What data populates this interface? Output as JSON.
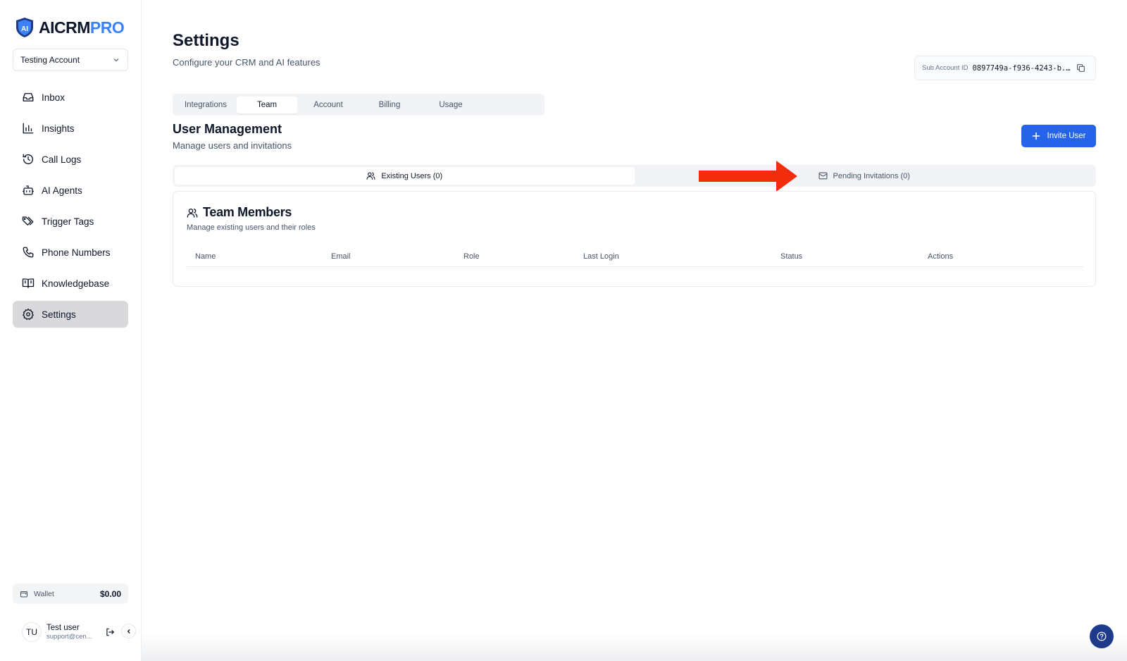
{
  "brand": {
    "name_part1": "AICRM",
    "name_part2": "PRO"
  },
  "account_selector": {
    "value": "Testing Account"
  },
  "sidebar": {
    "items": [
      {
        "label": "Inbox",
        "icon": "inbox-icon"
      },
      {
        "label": "Insights",
        "icon": "bar-chart-icon"
      },
      {
        "label": "Call Logs",
        "icon": "history-icon"
      },
      {
        "label": "AI Agents",
        "icon": "bot-icon"
      },
      {
        "label": "Trigger Tags",
        "icon": "tags-icon"
      },
      {
        "label": "Phone Numbers",
        "icon": "phone-icon"
      },
      {
        "label": "Knowledgebase",
        "icon": "book-icon"
      },
      {
        "label": "Settings",
        "icon": "gear-icon",
        "active": true
      }
    ]
  },
  "wallet": {
    "label": "Wallet",
    "amount": "$0.00"
  },
  "user": {
    "initials": "TU",
    "name": "Test user",
    "email": "support@cen..."
  },
  "header": {
    "title": "Settings",
    "subtitle": "Configure your CRM and AI features",
    "sub_account_label": "Sub Account ID",
    "sub_account_value": "0897749a-f936-4243-b..."
  },
  "tabs": [
    "Integrations",
    "Team",
    "Account",
    "Billing",
    "Usage"
  ],
  "active_tab": "Team",
  "section": {
    "title": "User Management",
    "subtitle": "Manage users and invitations",
    "invite_label": "Invite User"
  },
  "subtabs": {
    "existing": "Existing Users (0)",
    "pending": "Pending Invitations (0)"
  },
  "card": {
    "title": "Team Members",
    "subtitle": "Manage existing users and their roles",
    "columns": [
      "Name",
      "Email",
      "Role",
      "Last Login",
      "Status",
      "Actions"
    ]
  },
  "colors": {
    "accent": "#2563eb",
    "brand_blue": "#3b82f6",
    "annotation_arrow": "#f22d0e",
    "help_button": "#1e3a8a"
  }
}
